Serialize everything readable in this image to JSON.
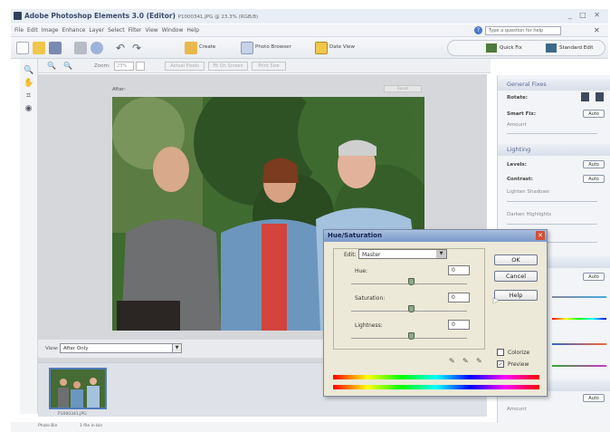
{
  "window": {
    "app_title": "Adobe Photoshop Elements 3.0 (Editor)",
    "doc_title": "P1000341.JPG @ 23.3% (RGB/8)",
    "controls": "_ □ ✕"
  },
  "menu": {
    "items": [
      "File",
      "Edit",
      "Image",
      "Enhance",
      "Layer",
      "Select",
      "Filter",
      "View",
      "Window",
      "Help"
    ],
    "help_placeholder": "Type a question for help"
  },
  "shortcuts": {
    "create": "Create",
    "photo_browser": "Photo Browser",
    "date_view": "Date View",
    "quick_fix": "Quick Fix",
    "standard_edit": "Standard Edit"
  },
  "options_bar": {
    "zoom_label": "Zoom:",
    "zoom_value": "23%",
    "actual_pixels": "Actual Pixels",
    "fit_on_screen": "Fit On Screen",
    "print_size": "Print Size"
  },
  "canvas": {
    "after_label": "After:",
    "reset_label": "Reset"
  },
  "view_bar": {
    "label": "View:",
    "value": "After Only"
  },
  "photo_bin": {
    "thumb_label": "P1000341.JPG"
  },
  "status_bar": {
    "bin_label": "Photo Bin",
    "frame_label": "1 file in bin"
  },
  "right_panel": {
    "general_fixes": "General Fixes",
    "rotate": "Rotate:",
    "smart_fix": "Smart Fix:",
    "auto": "Auto",
    "amount": "Amount",
    "lighting": "Lighting",
    "levels": "Levels:",
    "contrast": "Contrast:",
    "lighten_shadows": "Lighten Shadows",
    "darken_highlights": "Darken Highlights"
  },
  "dialog": {
    "title": "Hue/Saturation",
    "edit_label": "Edit:",
    "edit_value": "Master",
    "hue_label": "Hue:",
    "hue_value": "0",
    "saturation_label": "Saturation:",
    "saturation_value": "0",
    "lightness_label": "Lightness:",
    "lightness_value": "0",
    "ok": "OK",
    "cancel": "Cancel",
    "help": "Help",
    "colorize": "Colorize",
    "preview": "Preview",
    "preview_checked": true
  },
  "colors": {
    "accent": "#4a78c8",
    "dialog_title": "#7a98c9",
    "close_red": "#d44e33"
  }
}
